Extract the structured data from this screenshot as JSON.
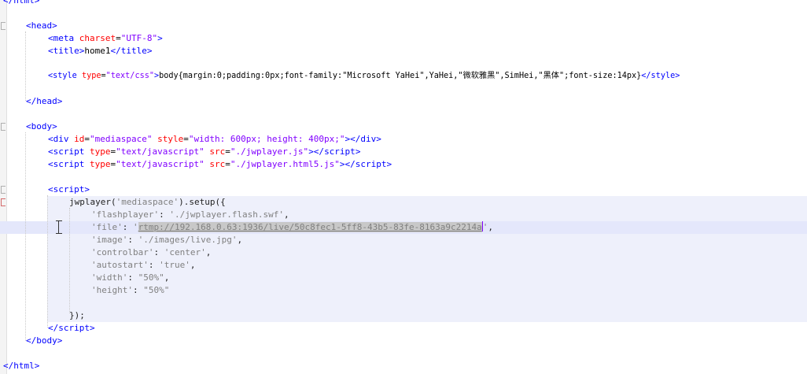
{
  "editor": {
    "lines": {
      "l0": {
        "a": "</",
        "b": "html",
        "c": ">"
      },
      "l1": {
        "a": "<",
        "b": "head",
        "c": ">"
      },
      "l2": {
        "a": "<",
        "b": "meta",
        "c": " ",
        "d": "charset",
        "e": "=",
        "f": "\"UTF-8\"",
        "g": ">"
      },
      "l3": {
        "a": "<",
        "b": "title",
        "c": ">",
        "d": "home1",
        "e": "</",
        "f": "title",
        "g": ">"
      },
      "l4": {
        "a": "<",
        "b": "style",
        "c": " ",
        "d": "type",
        "e": "=",
        "f": "\"text/css\"",
        "g": ">",
        "h": "body{margin:0;padding:0px;font-family:\"Microsoft YaHei\",YaHei,\"微软雅黑\",SimHei,\"黑体\";font-size:14px}",
        "i": "</",
        "j": "style",
        "k": ">"
      },
      "l5": {
        "a": "</",
        "b": "head",
        "c": ">"
      },
      "l6": {
        "a": "<",
        "b": "body",
        "c": ">"
      },
      "l7": {
        "a": "<",
        "b": "div",
        "c": " ",
        "d": "id",
        "e": "=",
        "f": "\"mediaspace\"",
        "g": " ",
        "h": "style",
        "i": "=",
        "j": "\"width: 600px; height: 400px;\"",
        "k": "></",
        "l": "div",
        "m": ">"
      },
      "l8": {
        "a": "<",
        "b": "script",
        "c": " ",
        "d": "type",
        "e": "=",
        "f": "\"text/javascript\"",
        "g": " ",
        "h": "src",
        "i": "=",
        "j": "\"./jwplayer.js\"",
        "k": "></",
        "l": "script",
        "m": ">"
      },
      "l9": {
        "a": "<",
        "b": "script",
        "c": " ",
        "d": "type",
        "e": "=",
        "f": "\"text/javascript\"",
        "g": " ",
        "h": "src",
        "i": "=",
        "j": "\"./jwplayer.html5.js\"",
        "k": "></",
        "l": "script",
        "m": ">"
      },
      "l10": {
        "a": "<",
        "b": "script",
        "c": ">"
      },
      "l11": {
        "a": "jwplayer(",
        "b": "'mediaspace'",
        "c": ").setup({"
      },
      "l12": {
        "a": "'flashplayer'",
        "b": ": ",
        "c": "'./jwplayer.flash.swf'",
        "d": ","
      },
      "l13": {
        "a": "'file'",
        "b": ": ",
        "c": "'",
        "d": "rtmp://192.168.0.63:1936/live/50c8fec1-5ff8-43b5-83fe-8163a9c2214a",
        "e": "'",
        "f": ","
      },
      "l14": {
        "a": "'image'",
        "b": ": ",
        "c": "'./images/live.jpg'",
        "d": ","
      },
      "l15": {
        "a": "'controlbar'",
        "b": ": ",
        "c": "'center'",
        "d": ","
      },
      "l16": {
        "a": "'autostart'",
        "b": ": ",
        "c": "'true'",
        "d": ","
      },
      "l17": {
        "a": "'width'",
        "b": ": ",
        "c": "\"50%\"",
        "d": ","
      },
      "l18": {
        "a": "'height'",
        "b": ": ",
        "c": "\"50%\""
      },
      "l19": {
        "a": "});"
      },
      "l20": {
        "a": "</",
        "b": "script",
        "c": ">"
      },
      "l21": {
        "a": "</",
        "b": "body",
        "c": ">"
      },
      "l22": {
        "a": "</",
        "b": "html",
        "c": ">"
      }
    }
  }
}
